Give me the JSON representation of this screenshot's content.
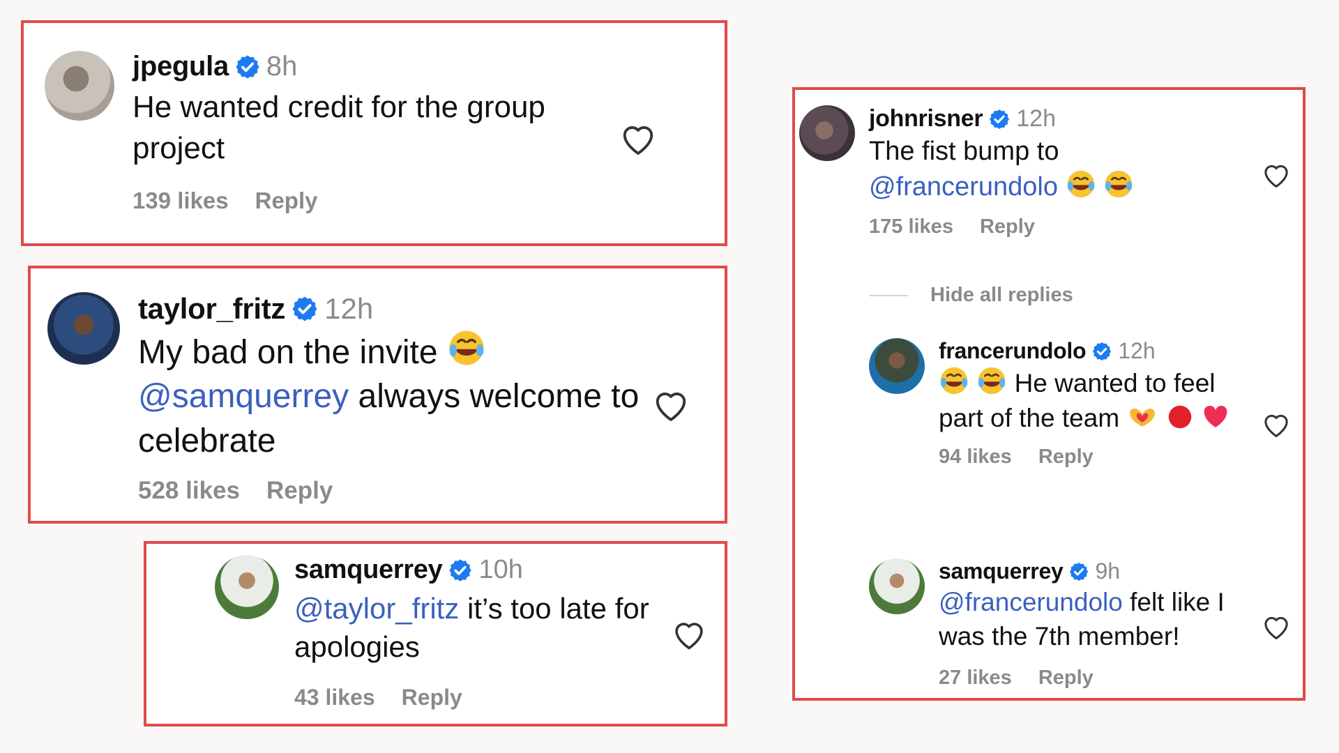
{
  "comments": [
    {
      "username": "jpegula",
      "time": "8h",
      "text_parts": [
        "He wanted credit for the group project"
      ],
      "likes": "139 likes",
      "reply": "Reply"
    },
    {
      "username": "taylor_fritz",
      "time": "12h",
      "text_pre": "My bad on the invite",
      "mention": "@samquerrey",
      "text_post": "always welcome to celebrate",
      "likes": "528 likes",
      "reply": "Reply"
    },
    {
      "username": "samquerrey",
      "time": "10h",
      "mention": "@taylor_fritz",
      "text_post": "it’s too late for apologies",
      "likes": "43 likes",
      "reply": "Reply"
    },
    {
      "username": "johnrisner",
      "time": "12h",
      "text_pre": "The fist bump to",
      "mention": "@francerundolo",
      "likes": "175 likes",
      "reply": "Reply",
      "hide_replies": "Hide all replies"
    },
    {
      "username": "francerundolo",
      "time": "12h",
      "text_pre": "He wanted to feel part of the team",
      "likes": "94 likes",
      "reply": "Reply"
    },
    {
      "username": "samquerrey",
      "time": "9h",
      "mention": "@francerundolo",
      "text_post": "felt like I was the 7th member!",
      "likes": "27 likes",
      "reply": "Reply"
    }
  ],
  "icons": {
    "verified": "verified-badge-icon",
    "like": "heart-icon",
    "emoji_laugh": "face-with-tears-of-joy-emoji",
    "emoji_hands": "heart-hands-emoji",
    "emoji_ball": "red-circle-emoji",
    "emoji_heart": "red-heart-emoji"
  },
  "colors": {
    "frame": "#e04a4a",
    "mention": "#3b5fc0",
    "verified": "#1d7bf2",
    "muted": "#8a8a8a"
  }
}
